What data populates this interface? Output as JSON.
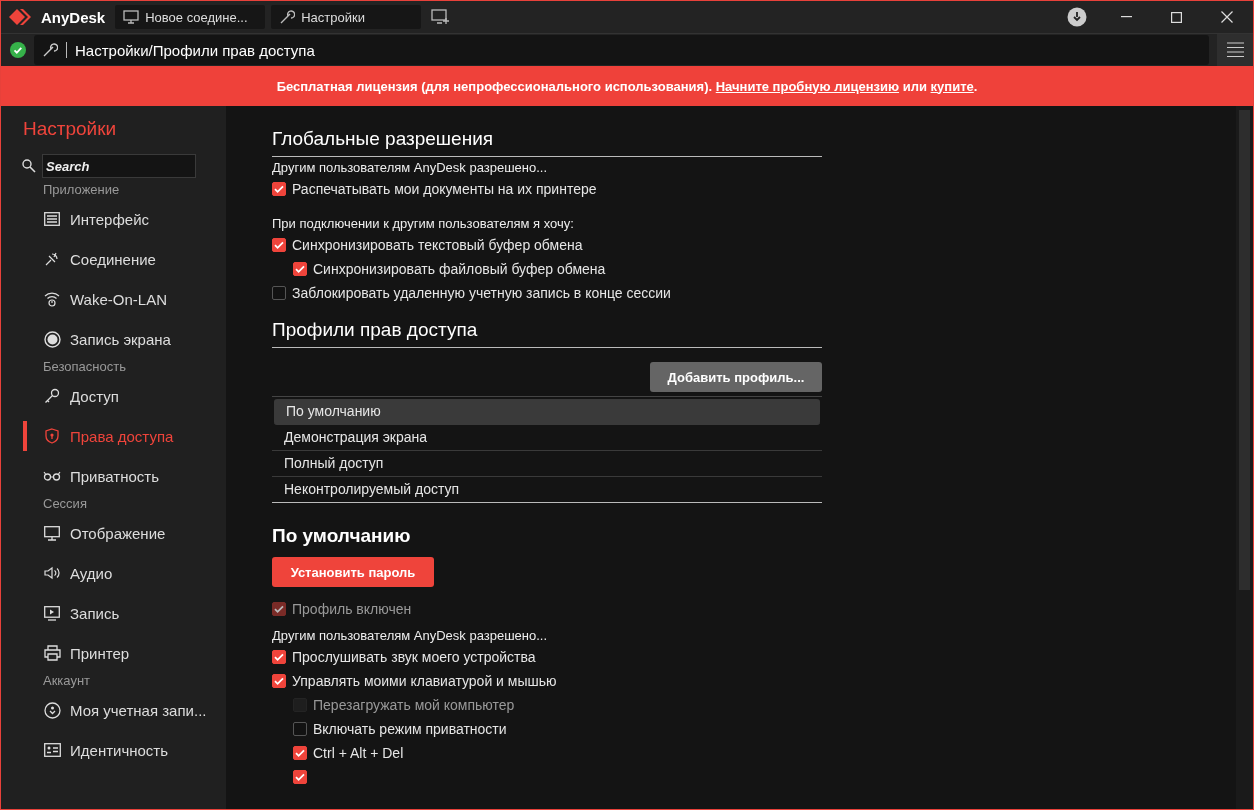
{
  "window": {
    "app_name": "AnyDesk",
    "tabs": [
      {
        "label": "Новое соедине...",
        "kind": "monitor"
      },
      {
        "label": "Настройки",
        "kind": "wrench"
      }
    ]
  },
  "address": {
    "path": "Настройки/Профили прав доступа",
    "connected": true
  },
  "banner": {
    "text": "Бесплатная лицензия (для непрофессионального использования).",
    "link_trial": "Начните пробную лицензию",
    "joiner": "или",
    "link_buy": "купите",
    "end": "."
  },
  "sidebar": {
    "title": "Настройки",
    "search_placeholder": "Search",
    "groups": [
      {
        "label": "Приложение",
        "items": [
          {
            "label": "Интерфейс",
            "kind": "interface",
            "selected": false
          },
          {
            "label": "Соединение",
            "kind": "connection",
            "selected": false
          },
          {
            "label": "Wake-On-LAN",
            "kind": "wol",
            "selected": false
          },
          {
            "label": "Запись экрана",
            "kind": "record",
            "selected": false
          }
        ]
      },
      {
        "label": "Безопасность",
        "items": [
          {
            "label": "Доступ",
            "kind": "key",
            "selected": false
          },
          {
            "label": "Права доступа",
            "kind": "shield",
            "selected": true
          },
          {
            "label": "Приватность",
            "kind": "glasses",
            "selected": false
          }
        ]
      },
      {
        "label": "Сессия",
        "items": [
          {
            "label": "Отображение",
            "kind": "monitor",
            "selected": false
          },
          {
            "label": "Аудио",
            "kind": "audio",
            "selected": false
          },
          {
            "label": "Запись",
            "kind": "play",
            "selected": false
          },
          {
            "label": "Принтер",
            "kind": "printer",
            "selected": false
          }
        ]
      },
      {
        "label": "Аккаунт",
        "items": [
          {
            "label": "Моя учетная запи...",
            "kind": "account",
            "selected": false
          },
          {
            "label": "Идентичность",
            "kind": "id",
            "selected": false
          }
        ]
      }
    ]
  },
  "global": {
    "title": "Глобальные разрешения",
    "groups": [
      {
        "intro": "Другим пользователям AnyDesk разрешено...",
        "options": [
          {
            "label": "Распечатывать мои документы на их принтере",
            "checked": true,
            "disabled": false
          }
        ]
      },
      {
        "intro": "При подключении к другим пользователям я хочу:",
        "options": [
          {
            "label": "Синхронизировать текстовый буфер обмена",
            "checked": true,
            "disabled": false,
            "children": [
              {
                "label": "Синхронизировать файловый буфер обмена",
                "checked": true,
                "disabled": false
              }
            ]
          },
          {
            "label": "Заблокировать удаленную учетную запись в конце сессии",
            "checked": false,
            "disabled": false
          }
        ]
      }
    ]
  },
  "profiles": {
    "title": "Профили прав доступа",
    "add_button": "Добавить профиль...",
    "items": [
      {
        "label": "По умолчанию",
        "selected": true
      },
      {
        "label": "Демонстрация экрана",
        "selected": false
      },
      {
        "label": "Полный доступ",
        "selected": false
      },
      {
        "label": "Неконтролируемый доступ",
        "selected": false
      }
    ]
  },
  "profile": {
    "title": "По умолчанию",
    "password_button": "Установить пароль",
    "enabled": {
      "label": "Профиль включен",
      "checked": true,
      "disabled": true
    },
    "intro": "Другим пользователям AnyDesk разрешено...",
    "options": [
      {
        "label": "Прослушивать звук моего устройства",
        "checked": true,
        "disabled": false
      },
      {
        "label": "Управлять моими клавиатурой и мышью",
        "checked": true,
        "disabled": false,
        "children": [
          {
            "label": "Перезагружать мой компьютер",
            "checked": false,
            "disabled": true
          },
          {
            "label": "Включать режим приватности",
            "checked": false,
            "disabled": false
          },
          {
            "label": "Ctrl + Alt + Del",
            "checked": true,
            "disabled": false
          },
          {
            "checked": true,
            "disabled": false
          }
        ]
      }
    ]
  }
}
